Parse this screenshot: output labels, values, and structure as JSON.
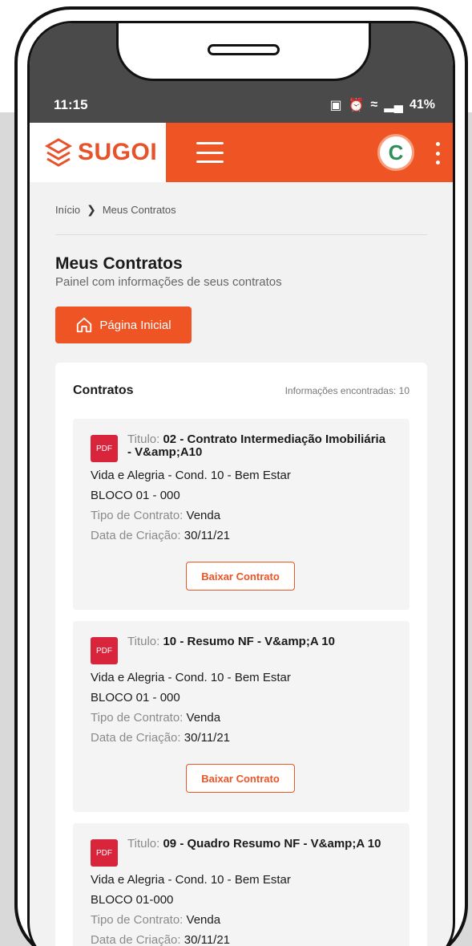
{
  "status_bar": {
    "time": "11:15",
    "icons": [
      "battery-saver-icon",
      "alarm-icon",
      "wifi-icon",
      "signal-icon"
    ],
    "battery": "41%"
  },
  "header": {
    "logo_text": "SUGOI",
    "avatar_letter": "C",
    "accent_color": "#ef5425"
  },
  "breadcrumb": {
    "home": "Início",
    "current": "Meus Contratos"
  },
  "page": {
    "title": "Meus Contratos",
    "subtitle": "Painel com informações de seus contratos",
    "home_button": "Página Inicial"
  },
  "panel": {
    "title": "Contratos",
    "count_text": "Informações encontradas: 10",
    "title_label": "Titulo:",
    "type_label": "Tipo de Contrato:",
    "date_label": "Data de Criação:",
    "download_label": "Baixar Contrato",
    "pdf_label": "PDF",
    "contracts": [
      {
        "title": "02 - Contrato Intermediação Imobiliária - V&amp;A10",
        "property": "Vida e Alegria - Cond. 10 - Bem Estar",
        "unit": "BLOCO 01 - 000",
        "type": "Venda",
        "created": "30/11/21"
      },
      {
        "title": "10 - Resumo NF - V&amp;A 10",
        "property": "Vida e Alegria - Cond. 10 - Bem Estar",
        "unit": "BLOCO 01 - 000",
        "type": "Venda",
        "created": "30/11/21"
      },
      {
        "title": "09 - Quadro Resumo NF - V&amp;A 10",
        "property": "Vida e Alegria - Cond. 10 - Bem Estar",
        "unit": "BLOCO 01-000",
        "type": "Venda",
        "created": "30/11/21"
      }
    ]
  }
}
